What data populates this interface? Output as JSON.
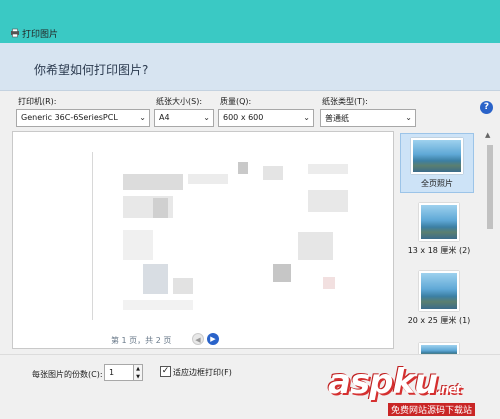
{
  "window": {
    "title": "打印图片"
  },
  "header": {
    "question": "你希望如何打印图片?"
  },
  "options": {
    "printer": {
      "label": "打印机(R):",
      "value": "Generic 36C-6SeriesPCL"
    },
    "paper_size": {
      "label": "纸张大小(S):",
      "value": "A4"
    },
    "quality": {
      "label": "质量(Q):",
      "value": "600 x 600"
    },
    "paper_type": {
      "label": "纸张类型(T):",
      "value": "普通纸"
    }
  },
  "preview": {
    "pager_text": "第 1 页，共 2 页"
  },
  "layouts": [
    {
      "label": "全页照片",
      "selected": true
    },
    {
      "label": "13 x 18 厘米 (2)",
      "selected": false
    },
    {
      "label": "20 x 25 厘米 (1)",
      "selected": false
    }
  ],
  "bottom": {
    "copies_label": "每张图片的份数(C):",
    "copies_value": "1",
    "fit_label": "适应边框打印(F)",
    "fit_checked": true
  },
  "watermark": {
    "text": "aspku",
    "suffix": ".net",
    "sub": "免费网站源码下载站"
  },
  "colors": {
    "titlebar": "#3ac9c4",
    "header_band": "#d7e4f1",
    "accent": "#2a63c9"
  }
}
